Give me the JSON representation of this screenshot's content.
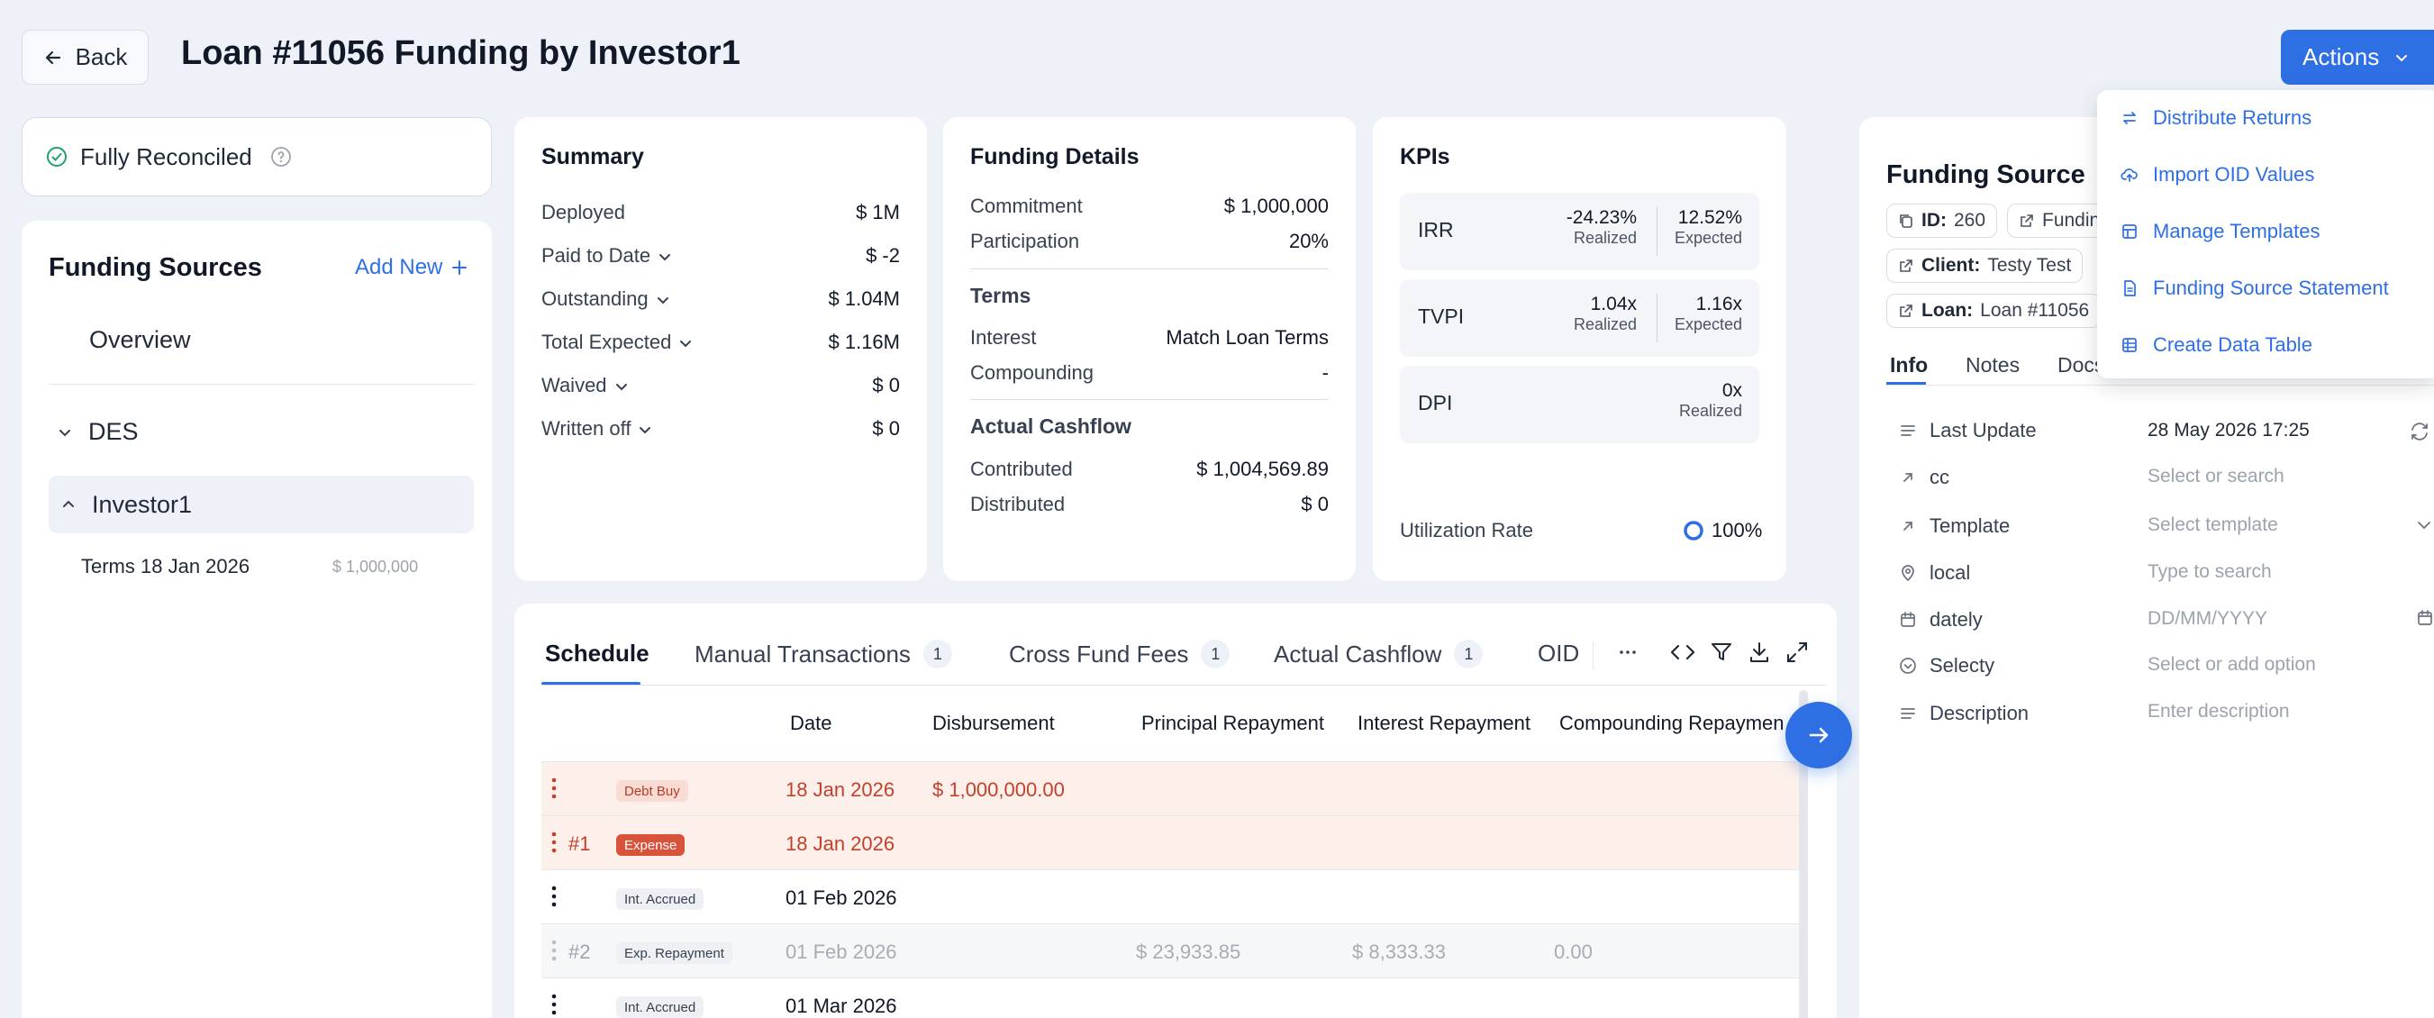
{
  "header": {
    "back_label": "Back",
    "title": "Loan #11056 Funding by Investor1",
    "actions_label": "Actions"
  },
  "reconciliation": {
    "status": "Fully Reconciled"
  },
  "funding_sources": {
    "title": "Funding Sources",
    "add_label": "Add New",
    "overview": "Overview",
    "group": "DES",
    "investor": "Investor1",
    "term_label": "Terms 18 Jan 2026",
    "term_amount": "$ 1,000,000"
  },
  "summary": {
    "title": "Summary",
    "rows": [
      {
        "label": "Deployed",
        "value": "$ 1M"
      },
      {
        "label": "Paid to Date",
        "value": "$ -2"
      },
      {
        "label": "Outstanding",
        "value": "$ 1.04M"
      },
      {
        "label": "Total Expected",
        "value": "$ 1.16M"
      },
      {
        "label": "Waived",
        "value": "$ 0"
      },
      {
        "label": "Written off",
        "value": "$ 0"
      }
    ]
  },
  "funding_details": {
    "title": "Funding Details",
    "commitment_label": "Commitment",
    "commitment": "$ 1,000,000",
    "participation_label": "Participation",
    "participation": "20%",
    "terms_title": "Terms",
    "interest_label": "Interest",
    "interest": "Match Loan Terms",
    "compounding_label": "Compounding",
    "compounding": "-",
    "cashflow_title": "Actual Cashflow",
    "contributed_label": "Contributed",
    "contributed": "$ 1,004,569.89",
    "distributed_label": "Distributed",
    "distributed": "$ 0"
  },
  "kpis": {
    "title": "KPIs",
    "irr_label": "IRR",
    "irr_realized": "-24.23%",
    "irr_expected": "12.52%",
    "tvpi_label": "TVPI",
    "tvpi_realized": "1.04x",
    "tvpi_expected": "1.16x",
    "dpi_label": "DPI",
    "dpi_realized": "0x",
    "realized_caption": "Realized",
    "expected_caption": "Expected",
    "utilization_label": "Utilization Rate",
    "utilization": "100%"
  },
  "schedule": {
    "tabs": [
      {
        "label": "Schedule"
      },
      {
        "label": "Manual Transactions",
        "count": "1"
      },
      {
        "label": "Cross Fund Fees",
        "count": "1"
      },
      {
        "label": "Actual Cashflow",
        "count": "1"
      },
      {
        "label": "OID"
      }
    ],
    "columns": [
      "Date",
      "Disbursement",
      "Principal Repayment",
      "Interest Repayment",
      "Compounding Repaymen"
    ],
    "rows": [
      {
        "num": "",
        "type": "Debt Buy",
        "date": "18 Jan 2026",
        "disbursement": "$ 1,000,000.00",
        "principal": "",
        "interest": "",
        "compounding": ""
      },
      {
        "num": "#1",
        "type": "Expense",
        "date": "18 Jan 2026",
        "disbursement": "",
        "principal": "",
        "interest": "",
        "compounding": ""
      },
      {
        "num": "",
        "type": "Int. Accrued",
        "date": "01 Feb 2026",
        "disbursement": "",
        "principal": "",
        "interest": "",
        "compounding": ""
      },
      {
        "num": "#2",
        "type": "Exp. Repayment",
        "date": "01 Feb 2026",
        "disbursement": "",
        "principal": "$ 23,933.85",
        "interest": "$ 8,333.33",
        "compounding": "0.00"
      },
      {
        "num": "",
        "type": "Int. Accrued",
        "date": "01 Mar 2026",
        "disbursement": "",
        "principal": "",
        "interest": "",
        "compounding": ""
      }
    ]
  },
  "funding_source_panel": {
    "title": "Funding Source",
    "id_label": "ID:",
    "id_value": "260",
    "funding_chip": "Fundin",
    "client_label": "Client:",
    "client_value": "Testy Test",
    "loan_label": "Loan:",
    "loan_value": "Loan #11056",
    "tabs": [
      "Info",
      "Notes",
      "Docs"
    ],
    "fields": [
      {
        "label": "Last Update",
        "value": "28 May 2026 17:25"
      },
      {
        "label": "cc",
        "value": "Select or search"
      },
      {
        "label": "Template",
        "value": "Select template"
      },
      {
        "label": "local",
        "value": "Type to search"
      },
      {
        "label": "dately",
        "value": "DD/MM/YYYY"
      },
      {
        "label": "Selecty",
        "value": "Select or add option"
      },
      {
        "label": "Description",
        "value": "Enter description"
      }
    ]
  },
  "actions_menu": {
    "items": [
      {
        "label": "Distribute Returns"
      },
      {
        "label": "Import OID Values"
      },
      {
        "label": "Manage Templates"
      },
      {
        "label": "Funding Source Statement"
      },
      {
        "label": "Create Data Table"
      }
    ]
  },
  "colors": {
    "accent": "#2f6fe4",
    "success": "#22a06b",
    "row_highlight": "#fdf0eb",
    "danger_text": "#c2412d"
  }
}
